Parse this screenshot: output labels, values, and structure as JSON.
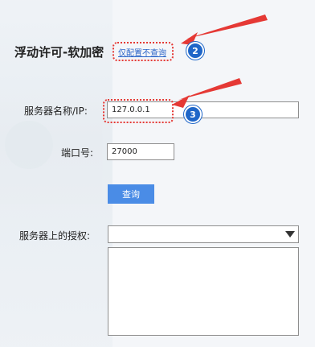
{
  "header": {
    "title": "浮动许可-软加密",
    "config_link": "仅配置不查询"
  },
  "form": {
    "server_label": "服务器名称/IP:",
    "server_value": "127.0.0.1",
    "port_label": "端口号:",
    "port_value": "27000",
    "query_button": "查询",
    "licenses_label": "服务器上的授权:",
    "licenses_selected": ""
  },
  "annotations": {
    "badge_2": "2",
    "badge_3": "3",
    "highlight_color": "#e53935",
    "badge_color": "#1f66c8"
  },
  "icons": {
    "dropdown": "triangle-down-icon"
  }
}
